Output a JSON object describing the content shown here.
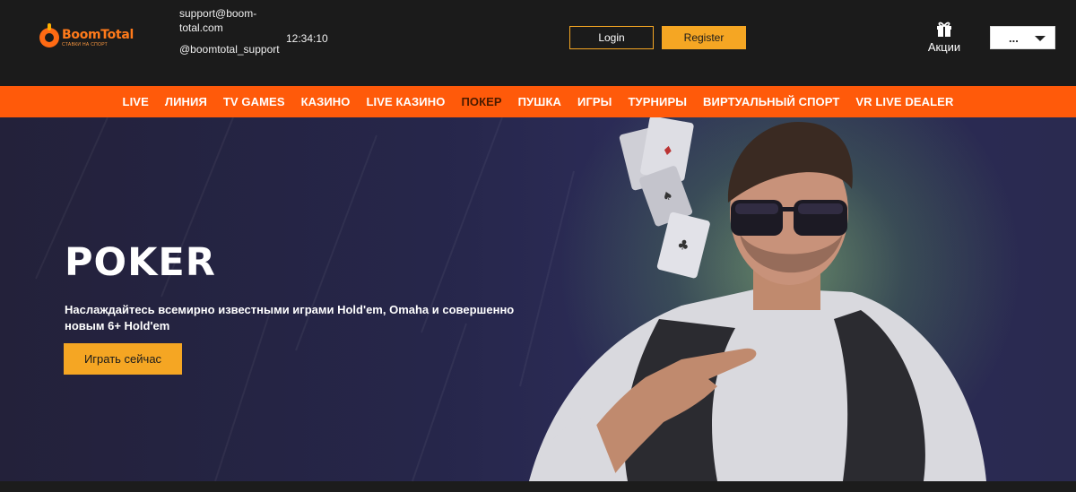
{
  "header": {
    "logo_word": "BoomTotal",
    "logo_tagline": "СТАВКИ НА СПОРТ",
    "support_email": "support@boom-total.com",
    "support_telegram": "@boomtotal_support",
    "clock": "12:34:10",
    "login_label": "Login",
    "register_label": "Register",
    "promo_label": "Акции",
    "promo_icon": "gift-icon",
    "language_value": "...",
    "accent_color": "#f5a623",
    "brand_color": "#ff5a0a"
  },
  "nav": {
    "items": [
      {
        "label": "LIVE",
        "active": false
      },
      {
        "label": "ЛИНИЯ",
        "active": false
      },
      {
        "label": "TV GAMES",
        "active": false
      },
      {
        "label": "КАЗИНО",
        "active": false
      },
      {
        "label": "LIVE КАЗИНО",
        "active": false
      },
      {
        "label": "ПОКЕР",
        "active": true
      },
      {
        "label": "ПУШКА",
        "active": false
      },
      {
        "label": "ИГРЫ",
        "active": false
      },
      {
        "label": "ТУРНИРЫ",
        "active": false
      },
      {
        "label": "ВИРТУАЛЬНЫЙ СПОРТ",
        "active": false
      },
      {
        "label": "VR LIVE DEALER",
        "active": false
      }
    ]
  },
  "hero": {
    "title": "POKER",
    "subtitle": "Наслаждайтесь всемирно известными играми Hold'em, Omaha и совершенно новым 6+ Hold'em",
    "cta_label": "Играть сейчас"
  }
}
